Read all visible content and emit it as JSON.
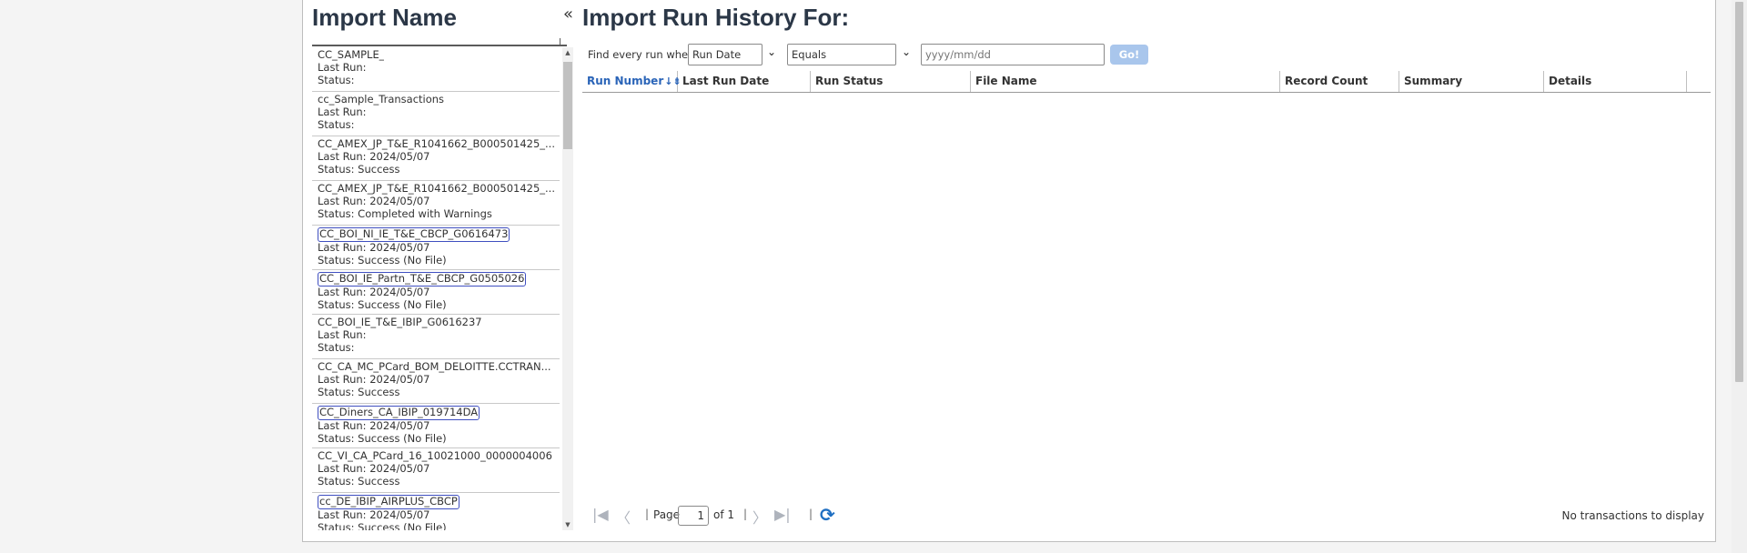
{
  "left_panel": {
    "title": "Import Name",
    "collapse_glyph": "«",
    "items": [
      {
        "name": "CC_SAMPLE_",
        "last_run": "Last Run:",
        "status": "Status:",
        "highlighted": false
      },
      {
        "name": "cc_Sample_Transactions",
        "last_run": "Last Run:",
        "status": "Status:",
        "highlighted": false
      },
      {
        "name": "CC_AMEX_JP_T&E_R1041662_B000501425_...",
        "last_run": "Last Run: 2024/05/07",
        "status": "Status: Success",
        "highlighted": false
      },
      {
        "name": "CC_AMEX_JP_T&E_R1041662_B000501425_...",
        "last_run": "Last Run: 2024/05/07",
        "status": "Status: Completed with Warnings",
        "highlighted": false
      },
      {
        "name": "CC_BOI_NI_IE_T&E_CBCP_G0616473",
        "last_run": "Last Run: 2024/05/07",
        "status": "Status: Success (No File)",
        "highlighted": true
      },
      {
        "name": "CC_BOI_IE_Partn_T&E_CBCP_G0505026",
        "last_run": "Last Run: 2024/05/07",
        "status": "Status: Success (No File)",
        "highlighted": true
      },
      {
        "name": "CC_BOI_IE_T&E_IBIP_G0616237",
        "last_run": "Last Run:",
        "status": "Status:",
        "highlighted": false
      },
      {
        "name": "CC_CA_MC_PCard_BOM_DELOITTE.CCTRAN...",
        "last_run": "Last Run: 2024/05/07",
        "status": "Status: Success",
        "highlighted": false
      },
      {
        "name": "CC_Diners_CA_IBIP_019714DA",
        "last_run": "Last Run: 2024/05/07",
        "status": "Status: Success (No File)",
        "highlighted": true
      },
      {
        "name": "CC_VI_CA_PCard_16_10021000_0000004006",
        "last_run": "Last Run: 2024/05/07",
        "status": "Status: Success",
        "highlighted": false
      },
      {
        "name": "cc_DE_IBIP_AIRPLUS_CBCP",
        "last_run": "Last Run: 2024/05/07",
        "status": "Status: Success (No File)",
        "highlighted": true
      }
    ]
  },
  "right_panel": {
    "title": "Import Run History For:",
    "filter": {
      "label": "Find every run where",
      "field_value": "Run Date",
      "operator_value": "Equals",
      "date_placeholder": "yyyy/mm/dd",
      "go_label": "Go!"
    },
    "columns": [
      "Run Number",
      "Last Run Date",
      "Run Status",
      "File Name",
      "Record Count",
      "Summary",
      "Details"
    ],
    "sort_glyph": "↓⇟",
    "pager": {
      "page_label": "Page",
      "page_value": "1",
      "of_label": "of 1",
      "empty_text": "No transactions to display"
    }
  },
  "colors": {
    "title": "#2b3747",
    "accent": "#2a64b8",
    "go_button": "#a9c6ec",
    "highlight_border": "#3f4fc0"
  },
  "icons": [
    "collapse-icon",
    "first-page-icon",
    "prev-page-icon",
    "next-page-icon",
    "last-page-icon",
    "refresh-icon",
    "sort-icon",
    "chevron-down-icon"
  ]
}
